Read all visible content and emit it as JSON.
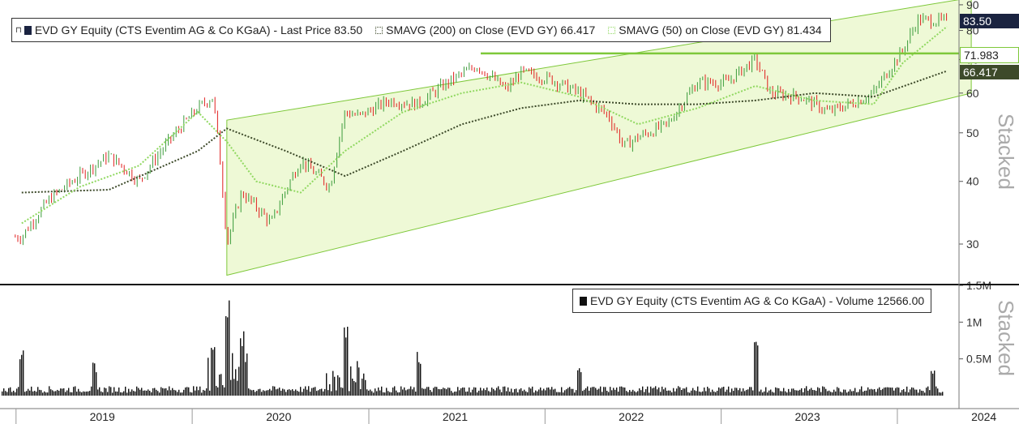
{
  "legend_top": {
    "price_label": "EVD GY Equity (CTS Eventim AG & Co KGaA) - Last Price 83.50",
    "sma200_label": "SMAVG (200)  on Close (EVD GY) 66.417",
    "sma50_label": "SMAVG (50)  on Close (EVD GY) 81.434"
  },
  "legend_bottom": {
    "volume_label": "EVD GY Equity (CTS Eventim AG & Co KGaA) - Volume 12566.00"
  },
  "stacked_label": "Stacked",
  "tags": {
    "last_price": "83.50",
    "resistance": "71.983",
    "sma200": "66.417"
  },
  "colors": {
    "background": "#ffffff",
    "channel_fill": "#eef9d6",
    "channel_line": "#7ec83a",
    "resistance_line": "#7ec83a",
    "up_candle": "#3a9b3a",
    "down_candle": "#e01e1e",
    "sma50": "#90d860",
    "sma200": "#3d4a2a",
    "volume": "#111111",
    "price_tag": "#1a2340",
    "sma200_tag": "#3d4a2a"
  },
  "chart_data": [
    {
      "type": "line",
      "name": "price",
      "y_scale": "log",
      "ylim": [
        25,
        92
      ],
      "y_ticks": [
        30,
        40,
        50,
        60,
        70,
        80,
        90
      ],
      "x_categories": [
        "2019",
        "2020",
        "2021",
        "2022",
        "2023",
        "2024"
      ],
      "series": [
        {
          "name": "EVD GY Equity (CTS Eventim AG & Co KGaA) - Last Price",
          "x": [
            "2019-01",
            "2019-03",
            "2019-05",
            "2019-07",
            "2019-09",
            "2019-11",
            "2020-01",
            "2020-02",
            "2020-03",
            "2020-04",
            "2020-06",
            "2020-08",
            "2020-10",
            "2020-11",
            "2020-12",
            "2021-02",
            "2021-04",
            "2021-06",
            "2021-08",
            "2021-10",
            "2021-11",
            "2022-01",
            "2022-03",
            "2022-05",
            "2022-06",
            "2022-07",
            "2022-09",
            "2022-11",
            "2023-01",
            "2023-03",
            "2023-04",
            "2023-06",
            "2023-08",
            "2023-10",
            "2023-11",
            "2024-01",
            "2024-02",
            "2024-04"
          ],
          "values": [
            31,
            37,
            41,
            45,
            40,
            48,
            56,
            59,
            30,
            38,
            33,
            44,
            39,
            55,
            54,
            58,
            57,
            63,
            68,
            61,
            66,
            64,
            60,
            54,
            47,
            49,
            52,
            63,
            63,
            70,
            60,
            59,
            55,
            58,
            60,
            73,
            84,
            83.5
          ]
        },
        {
          "name": "SMAVG (200)  on Close (EVD GY)",
          "x": [
            "2019-01",
            "2019-07",
            "2020-01",
            "2020-03",
            "2020-07",
            "2020-11",
            "2021-03",
            "2021-07",
            "2021-11",
            "2022-03",
            "2022-07",
            "2022-11",
            "2023-03",
            "2023-07",
            "2023-11",
            "2024-04"
          ],
          "values": [
            38,
            38.5,
            46,
            51,
            46,
            41,
            46,
            52,
            56,
            58,
            57,
            57,
            58,
            60,
            59,
            66.417
          ]
        },
        {
          "name": "SMAVG (50)  on Close (EVD GY)",
          "x": [
            "2019-01",
            "2019-05",
            "2019-09",
            "2020-01",
            "2020-03",
            "2020-05",
            "2020-08",
            "2020-11",
            "2021-03",
            "2021-07",
            "2021-11",
            "2022-03",
            "2022-07",
            "2022-11",
            "2023-03",
            "2023-07",
            "2023-11",
            "2024-01",
            "2024-04"
          ],
          "values": [
            33,
            39,
            43,
            55,
            48,
            40,
            38,
            46,
            55,
            60,
            63,
            59,
            52,
            56,
            62,
            58,
            57,
            69,
            81.434
          ]
        }
      ],
      "channel": {
        "lower": [
          {
            "x": "2020-03",
            "y": 26
          },
          {
            "x": "2024-04",
            "y": 60
          }
        ],
        "upper": [
          {
            "x": "2020-03",
            "y": 53
          },
          {
            "x": "2024-04",
            "y": 93
          }
        ]
      },
      "resistance": 71.983
    },
    {
      "type": "bar",
      "name": "volume",
      "ylim": [
        0,
        1500000
      ],
      "y_ticks": [
        {
          "v": 500000,
          "label": "0.5M"
        },
        {
          "v": 1000000,
          "label": "1M"
        },
        {
          "v": 1500000,
          "label": "1.5M"
        }
      ],
      "series": [
        {
          "name": "EVD GY Equity (CTS Eventim AG & Co KGaA) - Volume",
          "baseline": 100000,
          "spikes": [
            {
              "x": "2019-01",
              "v": 700000
            },
            {
              "x": "2019-06",
              "v": 450000
            },
            {
              "x": "2020-02",
              "v": 800000
            },
            {
              "x": "2020-03",
              "v": 1300000
            },
            {
              "x": "2020-04",
              "v": 900000
            },
            {
              "x": "2020-11",
              "v": 1050000
            },
            {
              "x": "2021-04",
              "v": 600000
            },
            {
              "x": "2022-03",
              "v": 450000
            },
            {
              "x": "2023-03",
              "v": 750000
            },
            {
              "x": "2024-03",
              "v": 400000
            }
          ],
          "last": 12566.0
        }
      ]
    }
  ]
}
